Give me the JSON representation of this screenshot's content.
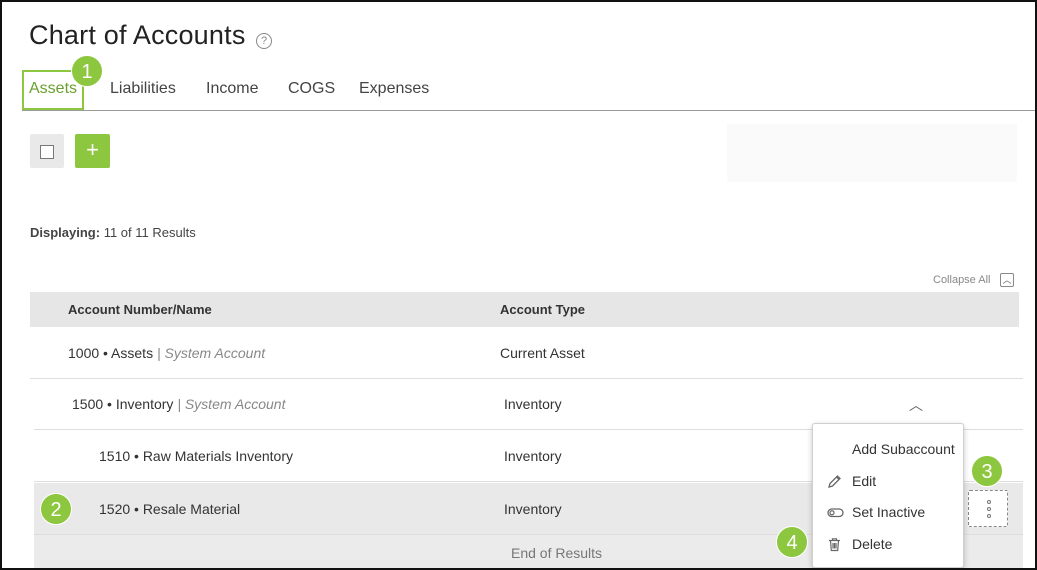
{
  "page": {
    "title": "Chart of Accounts"
  },
  "tabs": [
    {
      "label": "Assets",
      "active": true
    },
    {
      "label": "Liabilities"
    },
    {
      "label": "Income"
    },
    {
      "label": "COGS"
    },
    {
      "label": "Expenses"
    }
  ],
  "toolbar": {
    "add_label": "+"
  },
  "results": {
    "label": "Displaying:",
    "text": "11 of 11 Results"
  },
  "collapse_all": "Collapse All",
  "table": {
    "headers": [
      "Account Number/Name",
      "Account Type"
    ],
    "rows": [
      {
        "name": "1000 • Assets",
        "system": "| System Account",
        "type": "Current Asset"
      },
      {
        "name": "1500 • Inventory",
        "system": "| System Account",
        "type": "Inventory"
      },
      {
        "name": "1510 • Raw Materials Inventory",
        "system": "",
        "type": "Inventory"
      },
      {
        "name": "1520 • Resale Material",
        "system": "",
        "type": "Inventory"
      }
    ],
    "end_text": "End of Results"
  },
  "context_menu": {
    "items": [
      {
        "label": "Add Subaccount",
        "icon": "none"
      },
      {
        "label": "Edit",
        "icon": "pencil-icon"
      },
      {
        "label": "Set Inactive",
        "icon": "toggle-icon"
      },
      {
        "label": "Delete",
        "icon": "trash-icon"
      }
    ]
  },
  "callouts": [
    "1",
    "2",
    "3",
    "4"
  ],
  "colors": {
    "accent": "#8dc63f",
    "header_bg": "#e6e6e6",
    "selected_row": "#e9e9e9"
  }
}
